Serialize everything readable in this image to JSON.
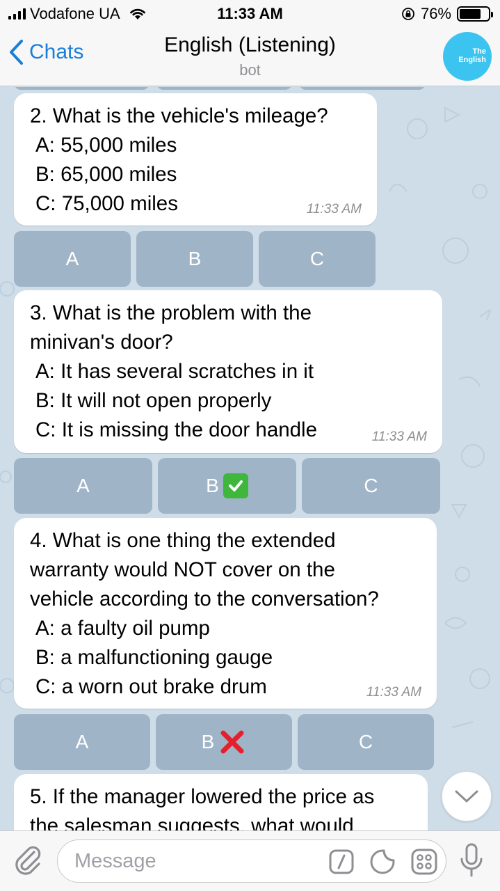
{
  "status_bar": {
    "carrier": "Vodafone UA",
    "time": "11:33 AM",
    "battery_text": "76%",
    "battery_level": 0.76
  },
  "nav": {
    "back_label": "Chats",
    "title": "English (Listening)",
    "subtitle": "bot",
    "avatar_line1": "The",
    "avatar_line2": "English"
  },
  "messages": [
    {
      "question": "2. What is the vehicle's mileage?",
      "options": [
        "A: 55,000 miles",
        "B: 65,000 miles",
        "C: 75,000 miles"
      ],
      "time": "11:33 AM",
      "buttons": [
        {
          "label": "A"
        },
        {
          "label": "B"
        },
        {
          "label": "C"
        }
      ]
    },
    {
      "question_lines": [
        "3. What is the problem with the",
        "minivan's door?"
      ],
      "options": [
        "A: It has several scratches in it",
        "B: It will not open properly",
        "C: It is missing the door handle"
      ],
      "time": "11:33 AM",
      "buttons": [
        {
          "label": "A"
        },
        {
          "label": "B",
          "mark": "check"
        },
        {
          "label": "C"
        }
      ]
    },
    {
      "question_lines": [
        "4. What is one thing the extended",
        "warranty would NOT cover on the",
        "vehicle according to the conversation?"
      ],
      "options": [
        "A: a faulty oil pump",
        "B: a malfunctioning gauge",
        "C: a worn out brake drum"
      ],
      "time": "11:33 AM",
      "buttons": [
        {
          "label": "A"
        },
        {
          "label": "B",
          "mark": "cross"
        },
        {
          "label": "C"
        }
      ]
    },
    {
      "question_lines": [
        "5. If the manager lowered the price as",
        "the salesman suggests, what would"
      ]
    }
  ],
  "input": {
    "placeholder": "Message"
  },
  "icons": {
    "attach": "paperclip-icon",
    "command": "slash-command-icon",
    "sticker": "sticker-icon",
    "grid": "app-grid-icon",
    "mic": "microphone-icon",
    "scroll": "chevron-down-icon"
  },
  "colors": {
    "accent": "#1a7ed8",
    "chat_background": "#cfdde9",
    "check": "#3fb63c",
    "cross": "#e5202a",
    "avatar": "#3cc4f0"
  }
}
